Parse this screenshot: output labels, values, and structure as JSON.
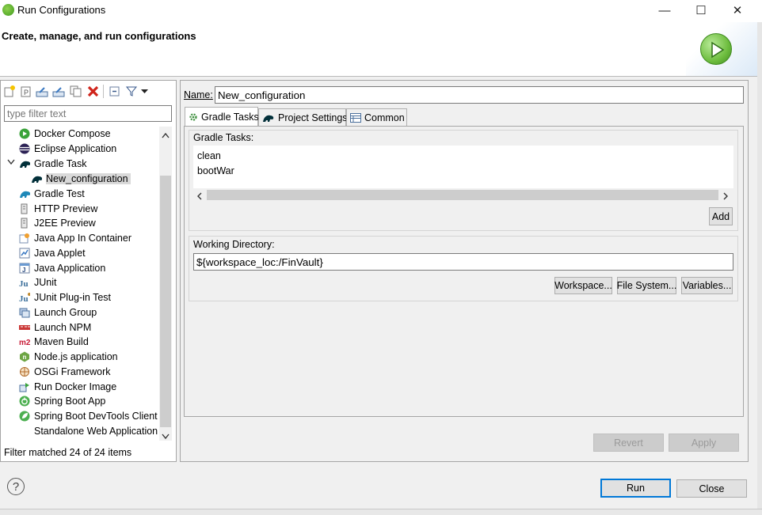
{
  "window": {
    "title": "Run Configurations",
    "minimize": "—",
    "maximize": "☐",
    "close": "✕"
  },
  "banner": {
    "title": "Create, manage, and run configurations"
  },
  "toolbar": {
    "icons": [
      "new-launch-configuration-icon",
      "new-prototype-icon",
      "export-icon",
      "import-icon",
      "duplicate-icon",
      "delete-icon",
      "collapse-all-icon",
      "filter-icon",
      "dropdown-icon"
    ]
  },
  "filter": {
    "placeholder": "type filter text"
  },
  "tree": {
    "items": [
      {
        "label": "Docker Compose",
        "icon": "docker-compose-icon"
      },
      {
        "label": "Eclipse Application",
        "icon": "eclipse-icon"
      },
      {
        "label": "Gradle Task",
        "icon": "gradle-icon",
        "expanded": true
      },
      {
        "label": "New_configuration",
        "icon": "gradle-icon",
        "selected": true
      },
      {
        "label": "Gradle Test",
        "icon": "gradle-icon"
      },
      {
        "label": "HTTP Preview",
        "icon": "http-preview-icon"
      },
      {
        "label": "J2EE Preview",
        "icon": "j2ee-preview-icon"
      },
      {
        "label": "Java App In Container",
        "icon": "java-container-icon"
      },
      {
        "label": "Java Applet",
        "icon": "java-applet-icon"
      },
      {
        "label": "Java Application",
        "icon": "java-application-icon"
      },
      {
        "label": "JUnit",
        "icon": "junit-icon"
      },
      {
        "label": "JUnit Plug-in Test",
        "icon": "junit-plugin-icon"
      },
      {
        "label": "Launch Group",
        "icon": "launch-group-icon"
      },
      {
        "label": "Launch NPM",
        "icon": "npm-icon"
      },
      {
        "label": "Maven Build",
        "icon": "maven-icon"
      },
      {
        "label": "Node.js application",
        "icon": "nodejs-icon"
      },
      {
        "label": "OSGi Framework",
        "icon": "osgi-icon"
      },
      {
        "label": "Run Docker Image",
        "icon": "docker-image-icon"
      },
      {
        "label": "Spring Boot App",
        "icon": "spring-boot-icon"
      },
      {
        "label": "Spring Boot DevTools Client",
        "icon": "spring-devtools-icon"
      },
      {
        "label": "Standalone Web Application",
        "icon": "none"
      }
    ],
    "status": "Filter matched 24 of 24 items"
  },
  "config": {
    "name_label": "Name:",
    "name_value": "New_configuration",
    "tabs": [
      {
        "label": "Gradle Tasks",
        "icon": "gear-icon",
        "active": true
      },
      {
        "label": "Project Settings",
        "icon": "gradle-icon"
      },
      {
        "label": "Common",
        "icon": "common-icon"
      }
    ],
    "gradle_tasks_label": "Gradle Tasks:",
    "tasks": [
      "clean",
      "bootWar"
    ],
    "add_label": "Add",
    "working_dir_label": "Working Directory:",
    "working_dir_value": "${workspace_loc:/FinVault}",
    "workspace_label": "Workspace...",
    "filesystem_label": "File System...",
    "variables_label": "Variables...",
    "revert_label": "Revert",
    "apply_label": "Apply"
  },
  "footer": {
    "help": "?",
    "run_label": "Run",
    "close_label": "Close"
  }
}
